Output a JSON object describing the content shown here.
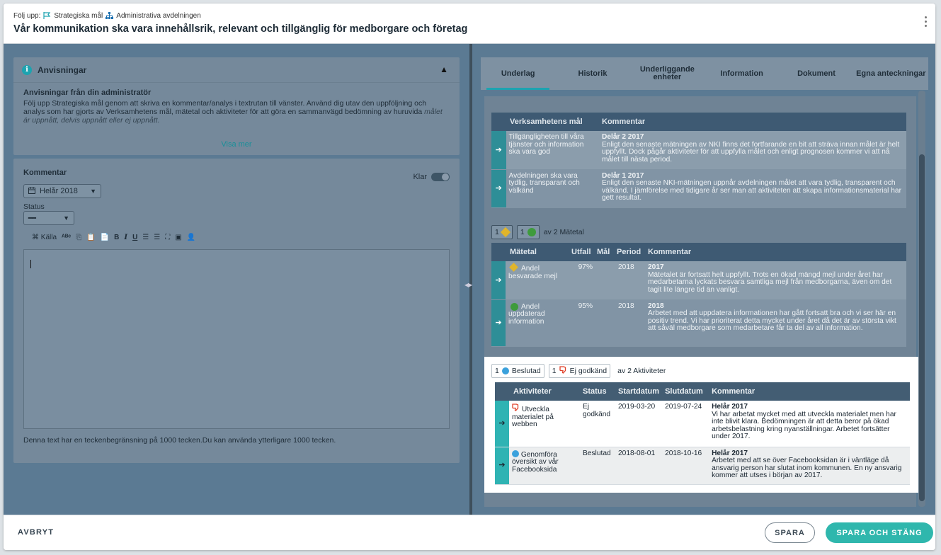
{
  "header": {
    "crumb_label": "Följ upp:",
    "crumb_goal": "Strategiska mål",
    "crumb_org": "Administrativa avdelningen",
    "title": "Vår kommunikation ska vara innehållsrik, relevant och tillgänglig för medborgare och företag"
  },
  "instructions": {
    "title": "Anvisningar",
    "subtitle": "Anvisningar från din administratör",
    "text": "Följ upp Strategiska mål genom att skriva en kommentar/analys i textrutan till vänster. Använd dig utav den uppföljning och analys som har gjorts av Verksamhetens mål, mätetal och aktiviteter för att göra en sammanvägd bedömning av huruvida",
    "text_cut": "målet är uppnått, delvis uppnått eller ej uppnått.",
    "show_more": "Visa mer"
  },
  "comment": {
    "title": "Kommentar",
    "done_label": "Klar",
    "period": "Helår 2018",
    "status_label": "Status",
    "status_value": "━━",
    "toolbar_source": "Källa",
    "limit_text": "Denna text har en teckenbegränsning på 1000 tecken.Du kan använda ytterligare 1000 tecken."
  },
  "tabs": [
    {
      "label": "Underlag"
    },
    {
      "label": "Historik"
    },
    {
      "label": "Underliggande enheter"
    },
    {
      "label": "Information"
    },
    {
      "label": "Dokument"
    },
    {
      "label": "Egna anteckningar"
    }
  ],
  "goals_table": {
    "headers": [
      "Verksamhetens mål",
      "Kommentar"
    ],
    "rows": [
      {
        "goal": "Tillgängligheten till våra tjänster och information ska vara god",
        "period": "Delår 2 2017",
        "comment": "Enligt den senaste mätningen av NKI finns det fortfarande en bit att sträva innan målet är helt uppfyllt. Dock pågår aktiviteter för att uppfylla målet och enligt prognosen kommer vi att nå målet till nästa period."
      },
      {
        "goal": "Avdelningen ska vara tydlig, transparant och välkänd",
        "period": "Delår 1 2017",
        "comment": "Enligt den senaste NKI-mätningen uppnår avdelningen målet att vara tydlig, transparent och välkänd. I jämförelse med tidigare år ser man att aktiviteten att skapa informationsmaterial har gett resultat."
      }
    ]
  },
  "metrics_summary": {
    "yellow_count": "1",
    "green_count": "1",
    "total": "av 2 Mätetal"
  },
  "metrics_table": {
    "headers": [
      "Mätetal",
      "Utfall",
      "Mål",
      "Period",
      "Kommentar"
    ],
    "rows": [
      {
        "name": "Andel besvarade mejl",
        "outcome": "97%",
        "target": "",
        "period": "2018",
        "year": "2017",
        "comment": "Mätetalet är fortsatt helt uppfyllt. Trots en ökad mängd mejl under året har medarbetarna lyckats besvara samtliga mejl från medborgarna, även om det tagit lite längre tid än vanligt.",
        "status_color": "#e0b52b"
      },
      {
        "name": "Andel uppdaterad information",
        "outcome": "95%",
        "target": "",
        "period": "2018",
        "year": "2018",
        "comment": "Arbetet med att uppdatera informationen har gått fortsatt bra och vi ser här en positiv trend. Vi har prioriterat detta mycket under året då det är av största vikt att såväl medborgare som medarbetare får ta del av all information.",
        "status_color": "#3e9b3c"
      }
    ]
  },
  "activities_summary": {
    "decided_count": "1",
    "decided_label": "Beslutad",
    "rejected_count": "1",
    "rejected_label": "Ej godkänd",
    "total": "av 2 Aktiviteter"
  },
  "activities_table": {
    "headers": [
      "Aktiviteter",
      "Status",
      "Startdatum",
      "Slutdatum",
      "Kommentar"
    ],
    "rows": [
      {
        "name": "Utveckla materialet på webben",
        "status": "Ej godkänd",
        "start": "2019-03-20",
        "end": "2019-07-24",
        "period": "Helår 2017",
        "comment": "Vi har arbetat mycket med att utveckla materialet men har inte blivit klara. Bedömningen är att detta beror på ökad arbetsbelastning kring nyanställningar. Arbetet fortsätter under 2017."
      },
      {
        "name": "Genomföra översikt av vår Facebooksida",
        "status": "Beslutad",
        "start": "2018-08-01",
        "end": "2018-10-16",
        "period": "Helår 2017",
        "comment": "Arbetet med att se över Facebooksidan är i väntläge då ansvarig person har slutat inom kommunen. En ny ansvarig kommer att utses i början av 2017."
      }
    ]
  },
  "footer": {
    "cancel": "AVBRYT",
    "save": "SPARA",
    "save_close": "SPARA OCH STÄNG"
  },
  "colors": {
    "accent": "#2fb7ad",
    "header_blue": "#3e5a73",
    "overlay": "#5b7a93"
  }
}
